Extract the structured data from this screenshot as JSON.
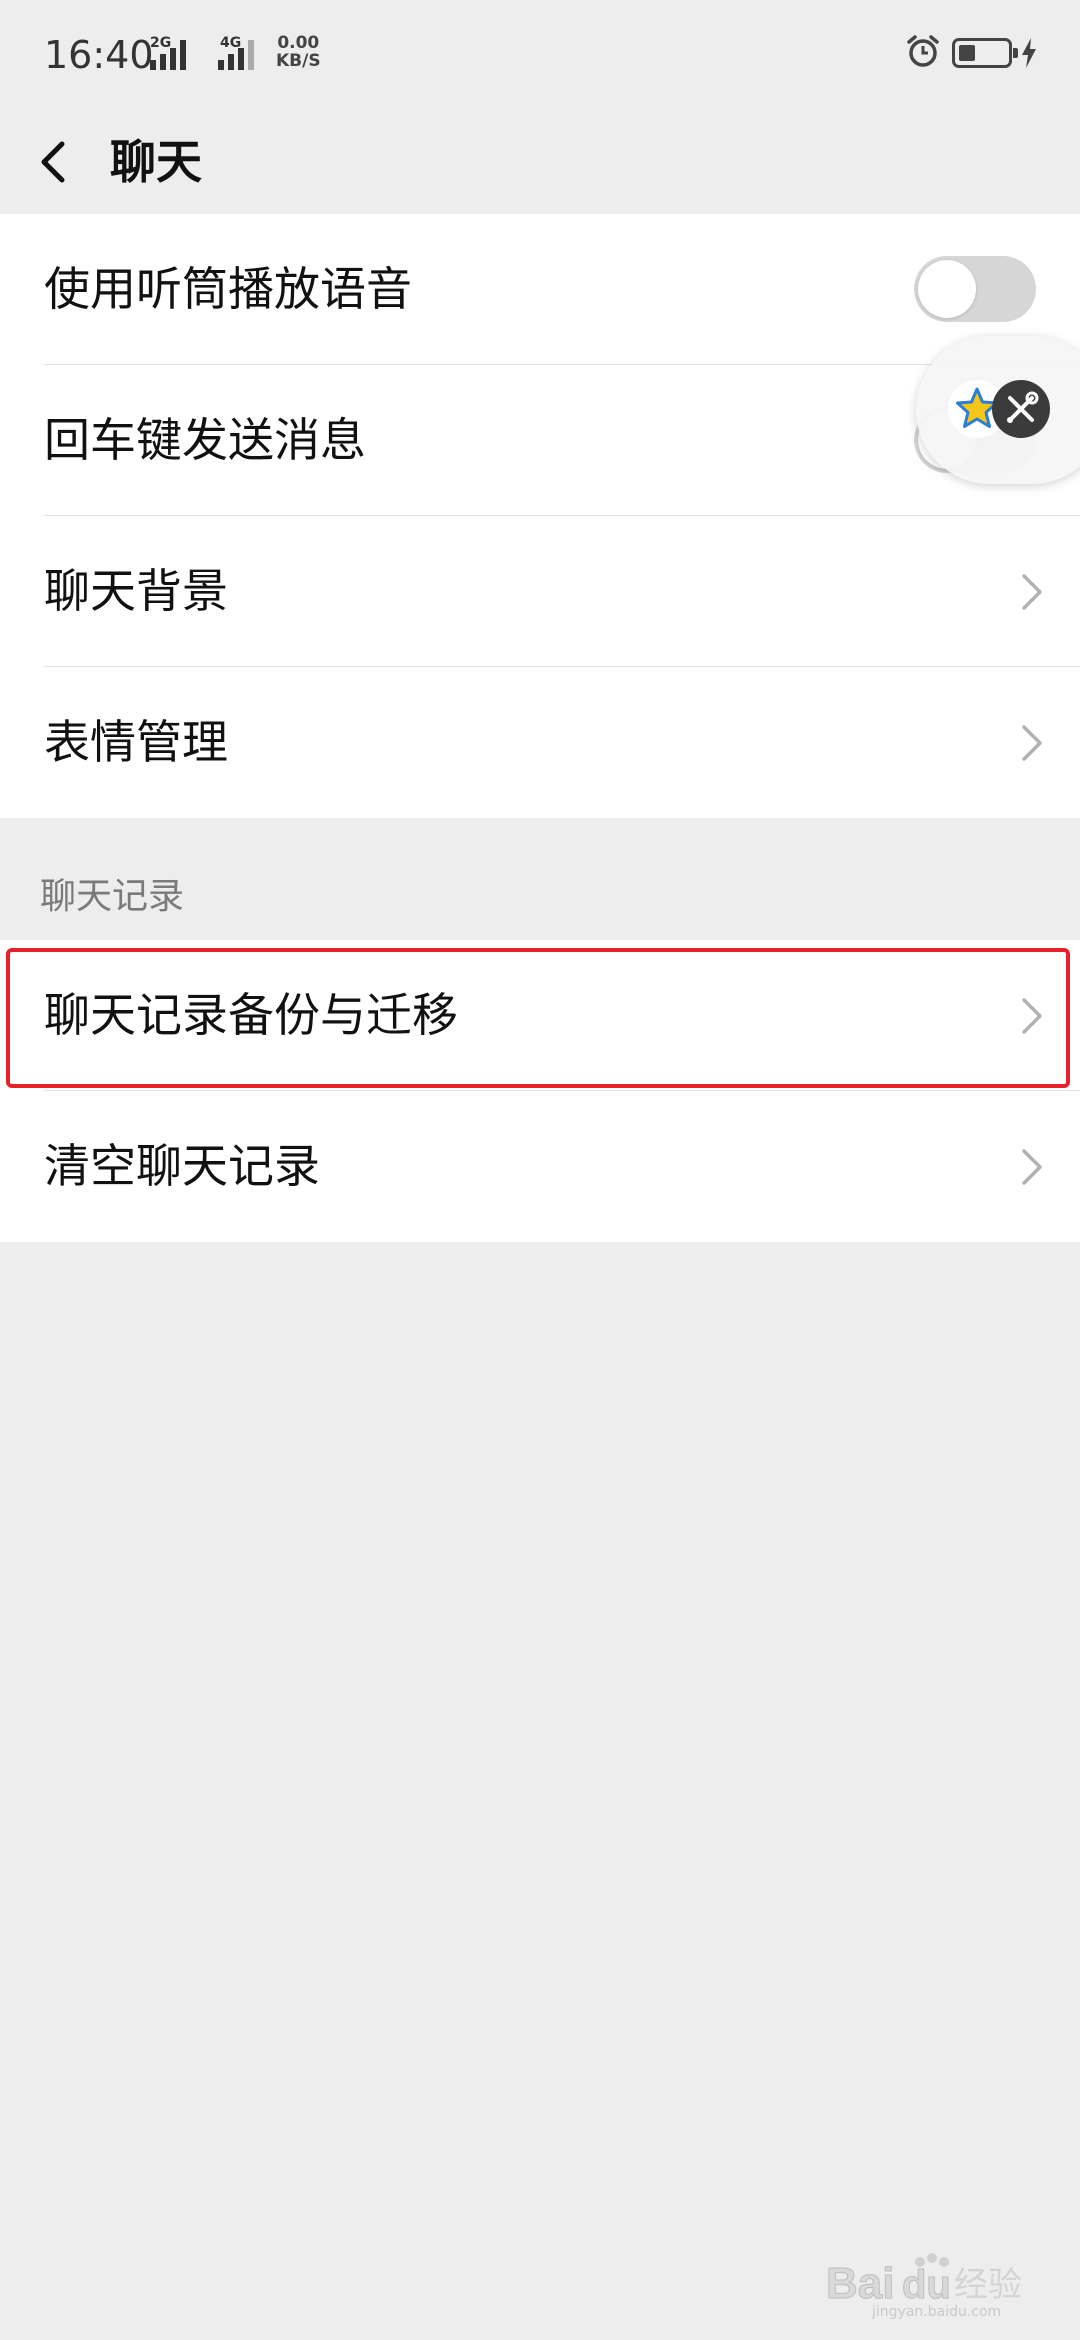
{
  "status_bar": {
    "time": "16:40",
    "network_1": "2G",
    "network_2": "4G",
    "speed_value": "0.00",
    "speed_unit": "KB/S",
    "icons": [
      "signal-icon",
      "alarm-icon",
      "battery-icon",
      "charging-icon"
    ]
  },
  "nav": {
    "title": "聊天",
    "back_icon": "chevron-left-icon"
  },
  "group1": {
    "items": [
      {
        "label": "使用听筒播放语音",
        "control": "toggle",
        "on": false
      },
      {
        "label": "回车键发送消息",
        "control": "toggle",
        "on": false
      },
      {
        "label": "聊天背景",
        "control": "chevron"
      },
      {
        "label": "表情管理",
        "control": "chevron"
      }
    ]
  },
  "section_header": "聊天记录",
  "group2": {
    "items": [
      {
        "label": "聊天记录备份与迁移",
        "control": "chevron",
        "highlighted": true
      },
      {
        "label": "清空聊天记录",
        "control": "chevron"
      }
    ]
  },
  "floating_bubble": {
    "icons": [
      "star-icon",
      "tools-icon"
    ]
  },
  "watermark": {
    "text": "Baidu经验",
    "domain": "jingyan.baidu.com"
  },
  "colors": {
    "background": "#ededed",
    "card": "#ffffff",
    "highlight": "#e8202a",
    "toggle_off": "#d6d6d6"
  }
}
